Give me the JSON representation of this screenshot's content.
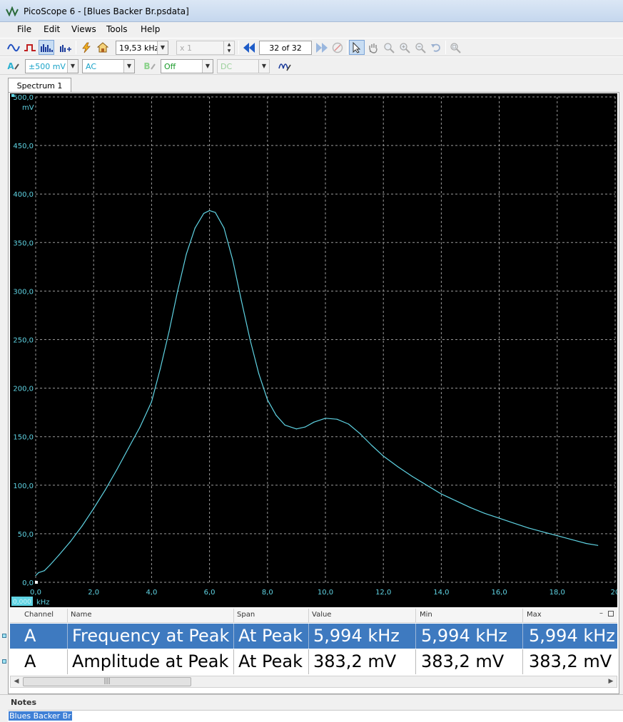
{
  "window": {
    "title": "PicoScope 6 - [Blues Backer Br.psdata]"
  },
  "menu": [
    "File",
    "Edit",
    "Views",
    "Tools",
    "Help"
  ],
  "toolbar1": {
    "timebase": "19,53 kHz",
    "multiplier": "x 1",
    "capture_position": "32 of 32"
  },
  "toolbar2": {
    "channel_a_label": "A",
    "channel_a_range": "±500 mV",
    "channel_a_coupling": "AC",
    "channel_b_label": "B",
    "channel_b_range": "Off",
    "channel_b_coupling": "DC"
  },
  "tab": {
    "label": "Spectrum 1"
  },
  "chart_data": {
    "type": "line",
    "y_unit": "mV",
    "x_unit": "kHz",
    "xlim": [
      0,
      20
    ],
    "ylim": [
      0,
      500
    ],
    "y_ticks": [
      "0,0",
      "50,0",
      "100,0",
      "150,0",
      "200,0",
      "250,0",
      "300,0",
      "350,0",
      "400,0",
      "450,0",
      "500,0"
    ],
    "x_ticks": [
      "0,0",
      "2,0",
      "4,0",
      "6,0",
      "8,0",
      "10,0",
      "12,0",
      "14,0",
      "16,0",
      "18,0",
      "20"
    ],
    "offset_label": "0,000",
    "grid": true,
    "line_color": "#5fd3e3",
    "background": "#000000",
    "series": [
      {
        "x": [
          0.0,
          0.1,
          0.3,
          0.5,
          0.8,
          1.2,
          1.6,
          2.0,
          2.4,
          2.8,
          3.2,
          3.6,
          4.0,
          4.3,
          4.6,
          4.9,
          5.2,
          5.5,
          5.8,
          6.0,
          6.2,
          6.5,
          6.8,
          7.1,
          7.4,
          7.7,
          8.0,
          8.3,
          8.6,
          9.0,
          9.3,
          9.6,
          10.0,
          10.4,
          10.8,
          11.2,
          11.6,
          12.0,
          12.5,
          13.0,
          13.5,
          14.0,
          14.5,
          15.0,
          15.5,
          16.0,
          16.5,
          17.0,
          17.5,
          18.0,
          18.5,
          19.0,
          19.4
        ],
        "y": [
          7,
          10,
          12,
          18,
          28,
          42,
          58,
          76,
          95,
          116,
          138,
          160,
          186,
          220,
          258,
          300,
          338,
          365,
          380,
          383,
          381,
          365,
          332,
          290,
          250,
          215,
          188,
          172,
          162,
          158,
          160,
          165,
          169,
          168,
          163,
          153,
          141,
          130,
          119,
          109,
          100,
          91,
          84,
          77,
          71,
          66,
          61,
          56,
          52,
          48,
          44,
          40,
          38
        ]
      }
    ]
  },
  "measurements": {
    "headers": [
      "Channel",
      "Name",
      "Span",
      "Value",
      "Min",
      "Max"
    ],
    "rows": [
      {
        "channel": "A",
        "name": "Frequency at Peak",
        "span": "At Peak",
        "value": "5,994 kHz",
        "min": "5,994 kHz",
        "max": "5,994 kHz"
      },
      {
        "channel": "A",
        "name": "Amplitude at Peak",
        "span": "At Peak",
        "value": "383,2 mV",
        "min": "383,2 mV",
        "max": "383,2 mV"
      }
    ]
  },
  "notes": {
    "title": "Notes",
    "text": "Blues Backer Br"
  }
}
